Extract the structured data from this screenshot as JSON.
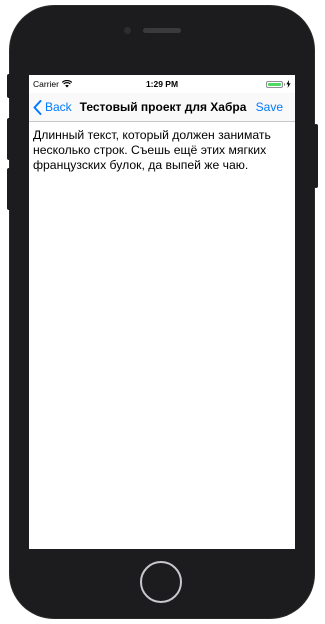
{
  "status_bar": {
    "carrier": "Carrier",
    "time": "1:29 PM",
    "battery_level": 1.0,
    "icons": [
      "wifi-icon",
      "battery-icon",
      "charging-icon"
    ]
  },
  "nav": {
    "back_label": "Back",
    "title": "Тестовый проект для Хабра",
    "save_label": "Save",
    "icons": [
      "chevron-left-icon"
    ]
  },
  "content": {
    "text": "Длинный текст, который должен занимать несколько строк. Съешь ещё этих мягких французских булок, да выпей же чаю."
  },
  "colors": {
    "accent": "#007aff",
    "battery": "#4cd964",
    "device": "#1c1c1e"
  }
}
